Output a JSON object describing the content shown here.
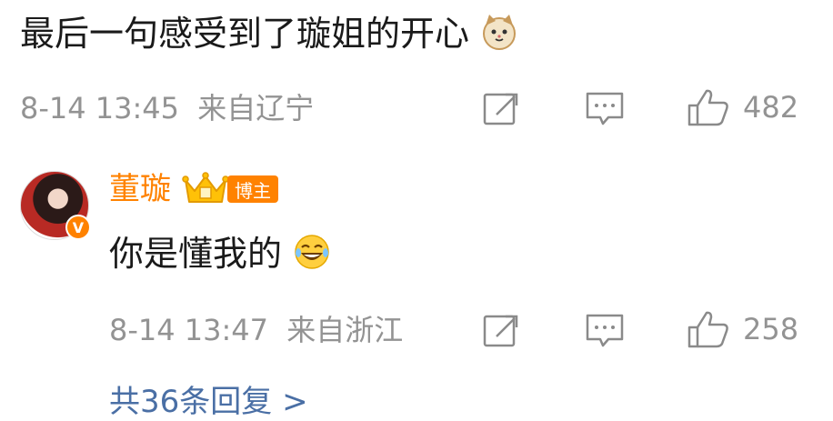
{
  "top_comment": {
    "text": "最后一句感受到了璇姐的开心",
    "emoji": "cat-emoji",
    "timestamp": "8-14 13:45",
    "location": "来自辽宁",
    "like_count": "482"
  },
  "reply": {
    "author": "董璇",
    "author_badge": "博主",
    "verified_mark": "V",
    "text": "你是懂我的",
    "emoji": "laugh-cry-emoji",
    "timestamp": "8-14 13:47",
    "location": "来自浙江",
    "like_count": "258"
  },
  "more_replies": {
    "label": "共36条回复 >"
  },
  "colors": {
    "accent_orange": "#ff8200",
    "meta_gray": "#939393",
    "link_blue": "#4a6fa5"
  },
  "icons": [
    "cat-emoji",
    "repost-icon",
    "comment-icon",
    "like-icon",
    "crown-icon",
    "laugh-cry-emoji"
  ]
}
